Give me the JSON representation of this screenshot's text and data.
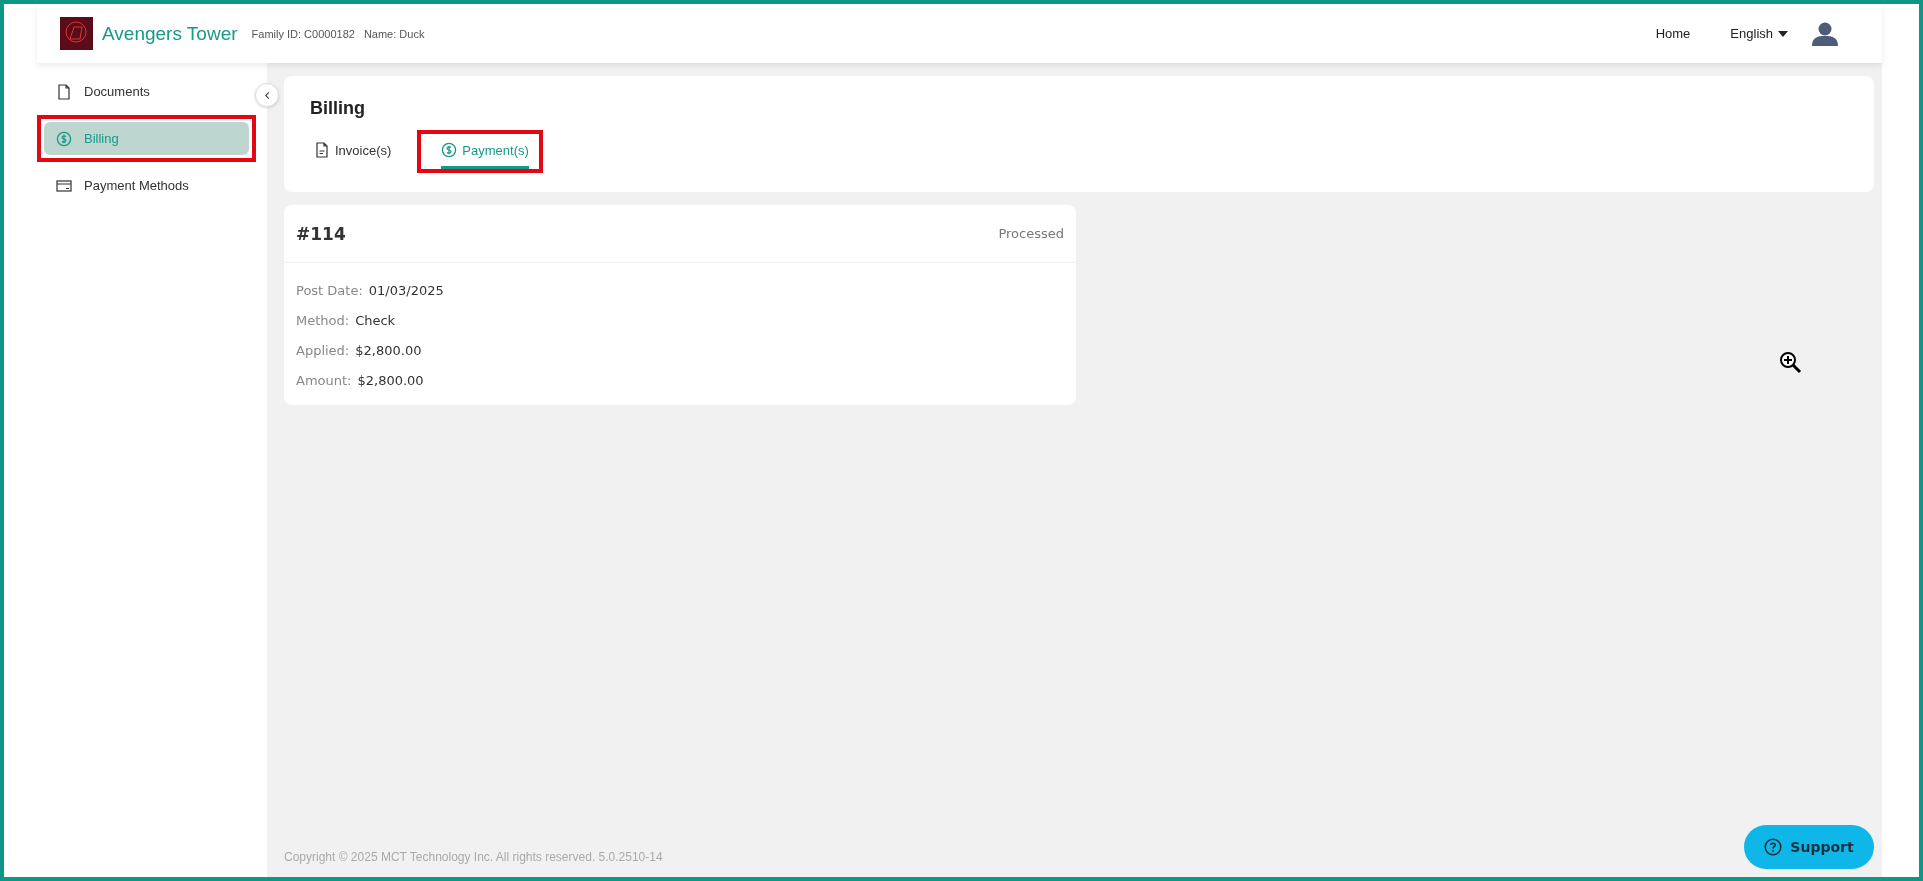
{
  "header": {
    "brand": "Avengers Tower",
    "family_id": "Family ID: C0000182",
    "name": "Name: Duck",
    "nav": "Home",
    "language": "English"
  },
  "sidebar": {
    "items": [
      {
        "label": "Documents",
        "kind": "document",
        "selected": false,
        "annotated": false
      },
      {
        "label": "Billing",
        "kind": "dollar",
        "selected": true,
        "annotated": true
      },
      {
        "label": "Payment Methods",
        "kind": "card",
        "selected": false,
        "annotated": false
      }
    ]
  },
  "page": {
    "title": "Billing",
    "tabs": [
      {
        "label": "Invoice(s)",
        "kind": "document",
        "selected": false,
        "annotated": false
      },
      {
        "label": "Payment(s)",
        "kind": "dollar",
        "selected": true,
        "annotated": true
      }
    ]
  },
  "payments": [
    {
      "number": "#114",
      "status": "Processed",
      "fields": [
        {
          "label": "Post Date:",
          "value": "01/03/2025"
        },
        {
          "label": "Method:",
          "value": "Check"
        },
        {
          "label": "Applied:",
          "value": "$2,800.00"
        },
        {
          "label": "Amount:",
          "value": "$2,800.00"
        }
      ]
    }
  ],
  "footer": {
    "copyright": "Copyright © 2025 MCT Technology Inc. All rights reserved. 5.0.2510-14",
    "support": "Support"
  }
}
